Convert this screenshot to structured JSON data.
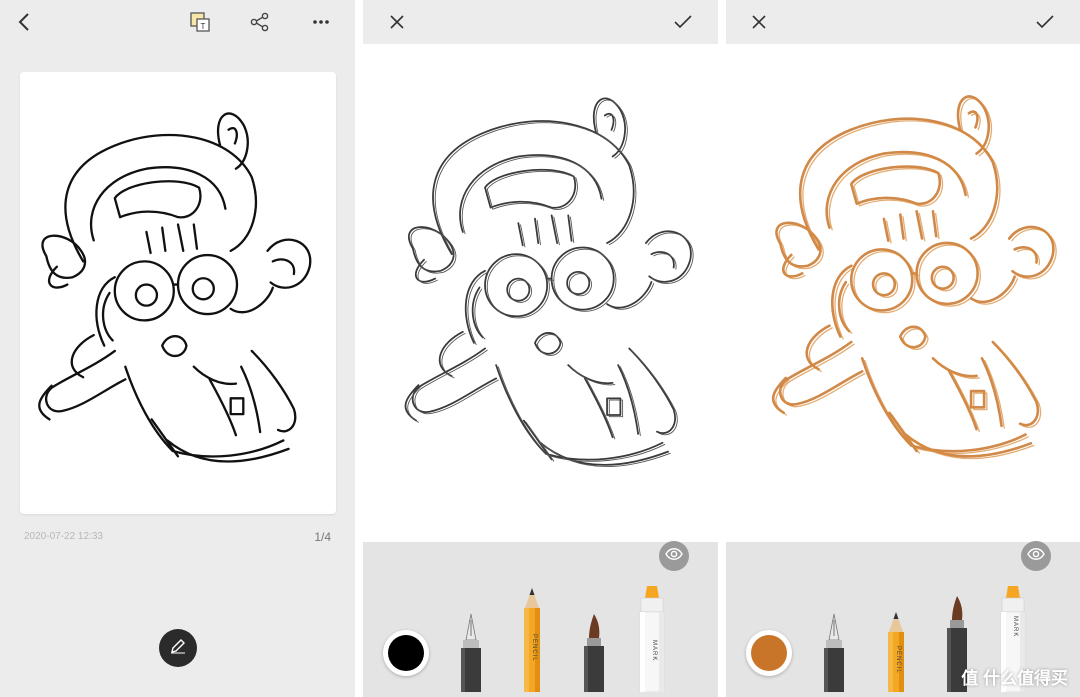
{
  "note_view": {
    "back_icon": "chevron-left-icon",
    "ocr_icon": "scan-text-icon",
    "share_icon": "share-icon",
    "more_icon": "more-dots-icon",
    "timestamp": "2020-07-22 12:33",
    "page_indicator": "1/4",
    "edit_icon": "pen-icon"
  },
  "editor_black": {
    "close_icon": "close-icon",
    "confirm_icon": "check-icon",
    "eye_icon": "eye-icon",
    "current_color": "#000000",
    "tools": [
      {
        "name": "fountain-pen",
        "label": ""
      },
      {
        "name": "pencil",
        "label": "PENCIL"
      },
      {
        "name": "brush-pen",
        "label": ""
      },
      {
        "name": "marker",
        "label": "MARK"
      }
    ]
  },
  "editor_orange": {
    "close_icon": "close-icon",
    "confirm_icon": "check-icon",
    "eye_icon": "eye-icon",
    "current_color": "#c8752a",
    "tools": [
      {
        "name": "fountain-pen",
        "label": ""
      },
      {
        "name": "pencil",
        "label": "PENCIL"
      },
      {
        "name": "brush-pen",
        "label": ""
      },
      {
        "name": "marker",
        "label": "MARK"
      }
    ],
    "watermark": "值 什么值得买"
  },
  "colors": {
    "panel_gray": "#ececec",
    "tool_tray": "#e4e4e4",
    "pencil_orange": "#f5a623",
    "ink_orange": "#c8752a"
  }
}
